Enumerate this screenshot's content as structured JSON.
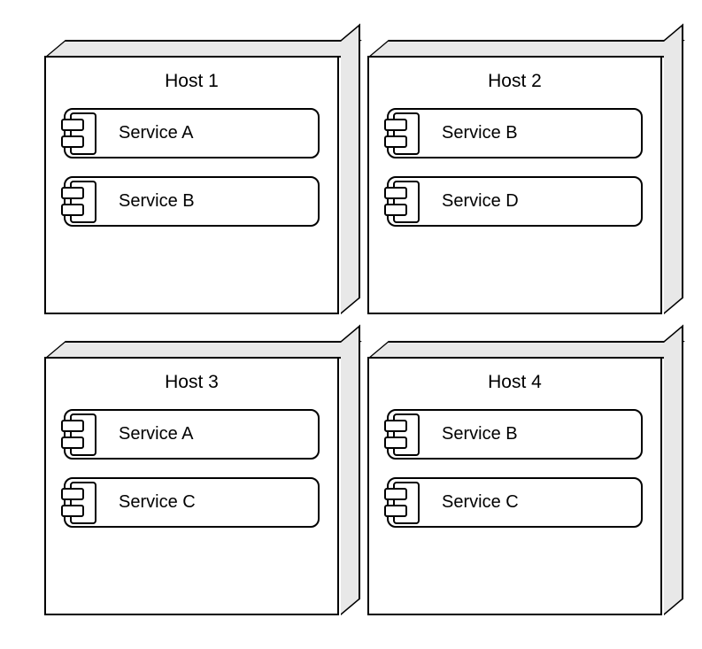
{
  "diagram_type": "deployment",
  "hosts": [
    {
      "title": "Host 1",
      "services": [
        "Service A",
        "Service B"
      ]
    },
    {
      "title": "Host 2",
      "services": [
        "Service B",
        "Service D"
      ]
    },
    {
      "title": "Host 3",
      "services": [
        "Service A",
        "Service C"
      ]
    },
    {
      "title": "Host 4",
      "services": [
        "Service B",
        "Service C"
      ]
    }
  ]
}
